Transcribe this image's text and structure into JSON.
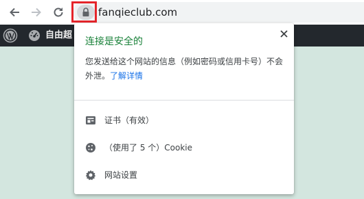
{
  "browser": {
    "url": "fanqieclub.com",
    "icons": {
      "back": "arrow-left-icon",
      "forward": "arrow-right-icon",
      "reload": "reload-icon",
      "lock": "lock-icon"
    },
    "highlight_color": "#e5242a"
  },
  "wp_admin_bar": {
    "site_label": "自由超",
    "icons": {
      "logo": "wordpress-logo-icon",
      "dashboard": "dashboard-gauge-icon"
    }
  },
  "site_info_popup": {
    "title": "连接是安全的",
    "description": "您发送给这个网站的信息（例如密码或信用卡号）不会外泄。",
    "learn_more": "了解详情",
    "items": [
      {
        "label": "证书（有效）",
        "icon": "certificate-icon"
      },
      {
        "label": "（使用了 5 个）Cookie",
        "icon": "cookie-icon"
      },
      {
        "label": "网站设置",
        "icon": "gear-icon"
      }
    ],
    "colors": {
      "title": "#188038",
      "link": "#1a73e8"
    }
  }
}
